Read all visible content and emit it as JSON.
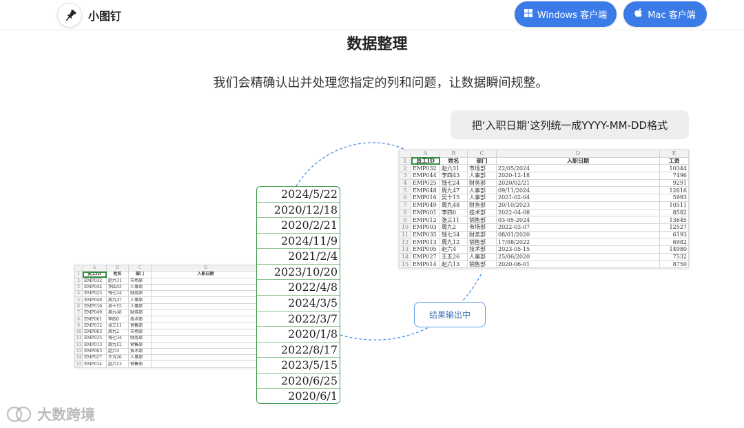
{
  "header": {
    "brand": "小图钉",
    "windows_button": "Windows 客户端",
    "mac_button": "Mac 客户端"
  },
  "hero": {
    "title": "数据整理",
    "subtitle": "我们会精确认出并处理您指定的列和问题，让数据瞬间规整。"
  },
  "prompt_bubble": "把‘入职日期’这列统一成YYYY-MM-DD格式",
  "status_pill": "结果输出中",
  "watermark": "大数跨境",
  "source_sheet": {
    "col_letters": [
      "A",
      "B",
      "C",
      "D"
    ],
    "headers": [
      "员工ID",
      "姓名",
      "部门",
      "入职日期"
    ],
    "rows": [
      [
        "2",
        "EMP032",
        "赵六31",
        "市场部"
      ],
      [
        "3",
        "EMP044",
        "李四43",
        "人事部"
      ],
      [
        "4",
        "EMP025",
        "钱七24",
        "财务部"
      ],
      [
        "5",
        "EMP048",
        "周九47",
        "人事部"
      ],
      [
        "6",
        "EMP016",
        "吴十15",
        "人事部"
      ],
      [
        "7",
        "EMP049",
        "周九48",
        "财务部"
      ],
      [
        "8",
        "EMP001",
        "李四0",
        "技术部"
      ],
      [
        "9",
        "EMP012",
        "张三11",
        "销售部"
      ],
      [
        "10",
        "EMP003",
        "周九2",
        "市场部"
      ],
      [
        "11",
        "EMP035",
        "钱七34",
        "财务部"
      ],
      [
        "12",
        "EMP013",
        "周九12",
        "销售部"
      ],
      [
        "13",
        "EMP005",
        "赵六4",
        "技术部"
      ],
      [
        "14",
        "EMP027",
        "王五26",
        "人事部"
      ],
      [
        "15",
        "EMP014",
        "赵六13",
        "销售部"
      ]
    ]
  },
  "dates_column": [
    "2024/5/22",
    "2020/12/18",
    "2020/2/21",
    "2024/11/9",
    "2021/2/4",
    "2023/10/20",
    "2022/4/8",
    "2024/3/5",
    "2022/3/7",
    "2020/1/8",
    "2022/8/17",
    "2023/5/15",
    "2020/6/25",
    "2020/6/1"
  ],
  "result_sheet": {
    "col_letters": [
      "A",
      "B",
      "C",
      "D",
      "E"
    ],
    "headers": [
      "员工ID",
      "姓名",
      "部门",
      "入职日期",
      "工资"
    ],
    "rows": [
      [
        "2",
        "EMP032",
        "赵六31",
        "市场部",
        "22/05/2024",
        "10344"
      ],
      [
        "3",
        "EMP044",
        "李四43",
        "人事部",
        "2020-12-18",
        "7496"
      ],
      [
        "4",
        "EMP025",
        "钱七24",
        "财务部",
        "2020/02/21",
        "9291"
      ],
      [
        "5",
        "EMP048",
        "周九47",
        "人事部",
        "09/11/2024",
        "12616"
      ],
      [
        "6",
        "EMP016",
        "吴十15",
        "人事部",
        "2021-02-04",
        "5993"
      ],
      [
        "7",
        "EMP049",
        "周九48",
        "财务部",
        "20/10/2023",
        "10511"
      ],
      [
        "8",
        "EMP001",
        "李四0",
        "技术部",
        "2022-04-08",
        "8582"
      ],
      [
        "9",
        "EMP012",
        "张三11",
        "销售部",
        "03-05-2024",
        "13645"
      ],
      [
        "10",
        "EMP003",
        "周九2",
        "市场部",
        "2022-03-07",
        "12527"
      ],
      [
        "11",
        "EMP035",
        "钱七34",
        "财务部",
        "08/01/2020",
        "6193"
      ],
      [
        "12",
        "EMP013",
        "周九12",
        "销售部",
        "17/08/2022",
        "6982"
      ],
      [
        "13",
        "EMP005",
        "赵六4",
        "技术部",
        "2023-05-15",
        "14980"
      ],
      [
        "14",
        "EMP027",
        "王五26",
        "人事部",
        "25/06/2020",
        "7532"
      ],
      [
        "15",
        "EMP014",
        "赵六13",
        "销售部",
        "2020-06-01",
        "8750"
      ]
    ]
  },
  "colors": {
    "accent_blue": "#3a7be8",
    "selection_green": "#2f8f3a",
    "dashed_line": "#4a90e2"
  },
  "icons": {
    "logo": "pushpin-icon",
    "windows": "windows-icon",
    "mac": "apple-icon"
  }
}
